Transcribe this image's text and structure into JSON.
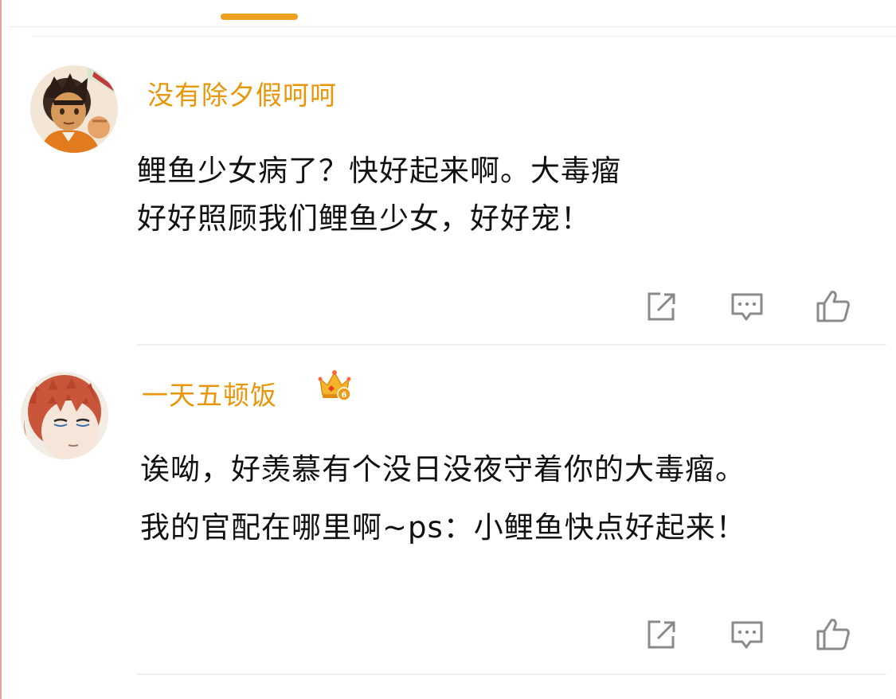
{
  "comments": [
    {
      "username": "没有除夕假呵呵",
      "lines": [
        "鲤鱼少女病了？快好起来啊。大毒瘤",
        "好好照顾我们鲤鱼少女，好好宠！"
      ],
      "avatar_icon": "anime-boy-avatar",
      "has_badge": false
    },
    {
      "username": "一天五顿饭",
      "lines": [
        "诶呦，好羡慕有个没日没夜守着你的大毒瘤。",
        "我的官配在哪里啊~ps：小鲤鱼快点好起来！"
      ],
      "avatar_icon": "anime-redhead-avatar",
      "has_badge": true,
      "badge_icon": "crown-level-badge-icon",
      "badge_level": "6"
    }
  ],
  "action_icons": [
    "share-icon",
    "comment-icon",
    "like-icon"
  ],
  "colors": {
    "username": "#e8950a",
    "tab_indicator": "#f0a020",
    "icon": "#8a8a8a"
  }
}
